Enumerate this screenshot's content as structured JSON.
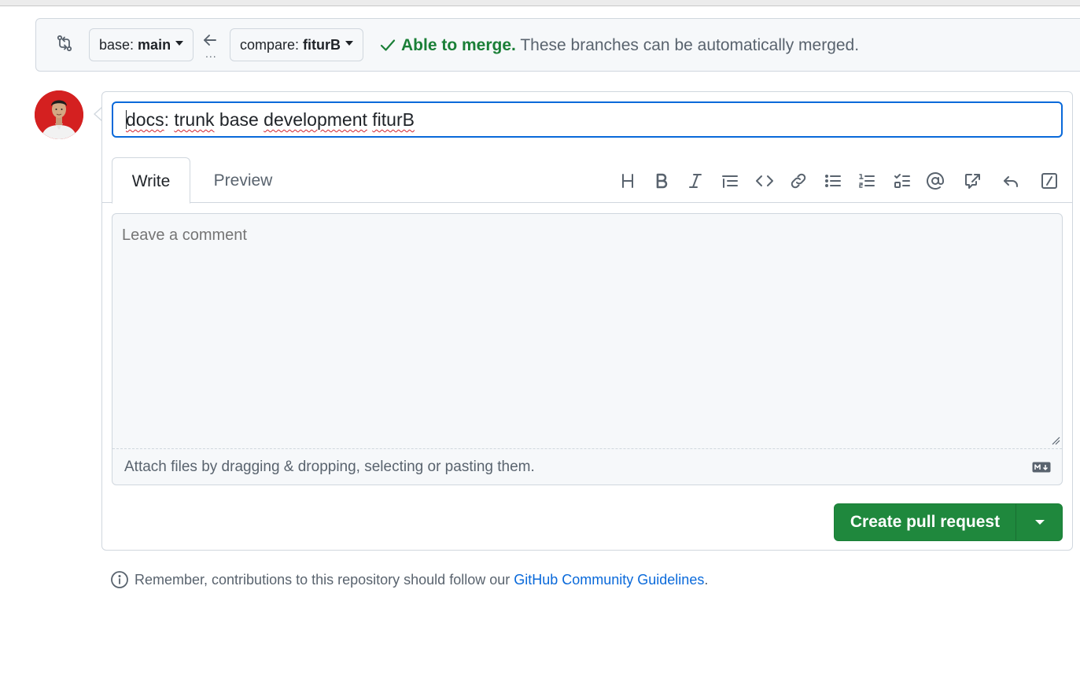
{
  "compare_bar": {
    "base_prefix": "base: ",
    "base_branch": "main",
    "compare_prefix": "compare: ",
    "compare_branch": "fiturB",
    "swap_dots": "...",
    "merge_ok": "Able to merge.",
    "merge_message": " These branches can be automatically merged."
  },
  "form": {
    "title_value_parts": [
      "docs",
      ": ",
      "trunk",
      " base ",
      "development",
      " ",
      "fiturB"
    ],
    "tabs": [
      "Write",
      "Preview"
    ],
    "toolbar_icons": [
      "heading-icon",
      "bold-icon",
      "italic-icon",
      "quote-icon",
      "code-icon",
      "link-icon",
      "unordered-list-icon",
      "ordered-list-icon",
      "task-list-icon",
      "mention-icon",
      "cross-reference-icon",
      "reply-icon",
      "slash-command-icon"
    ],
    "comment_placeholder": "Leave a comment",
    "attach_hint": "Attach files by dragging & dropping, selecting or pasting them.",
    "create_button_label": "Create pull request"
  },
  "footer": {
    "note_prefix": "Remember, contributions to this repository should follow our ",
    "link_text": "GitHub Community Guidelines",
    "note_suffix": "."
  },
  "colors": {
    "accent_blue": "#0969da",
    "success_green": "#1a7f37",
    "button_green": "#1f883d",
    "muted_text": "#59636e",
    "border": "#d0d7de"
  }
}
